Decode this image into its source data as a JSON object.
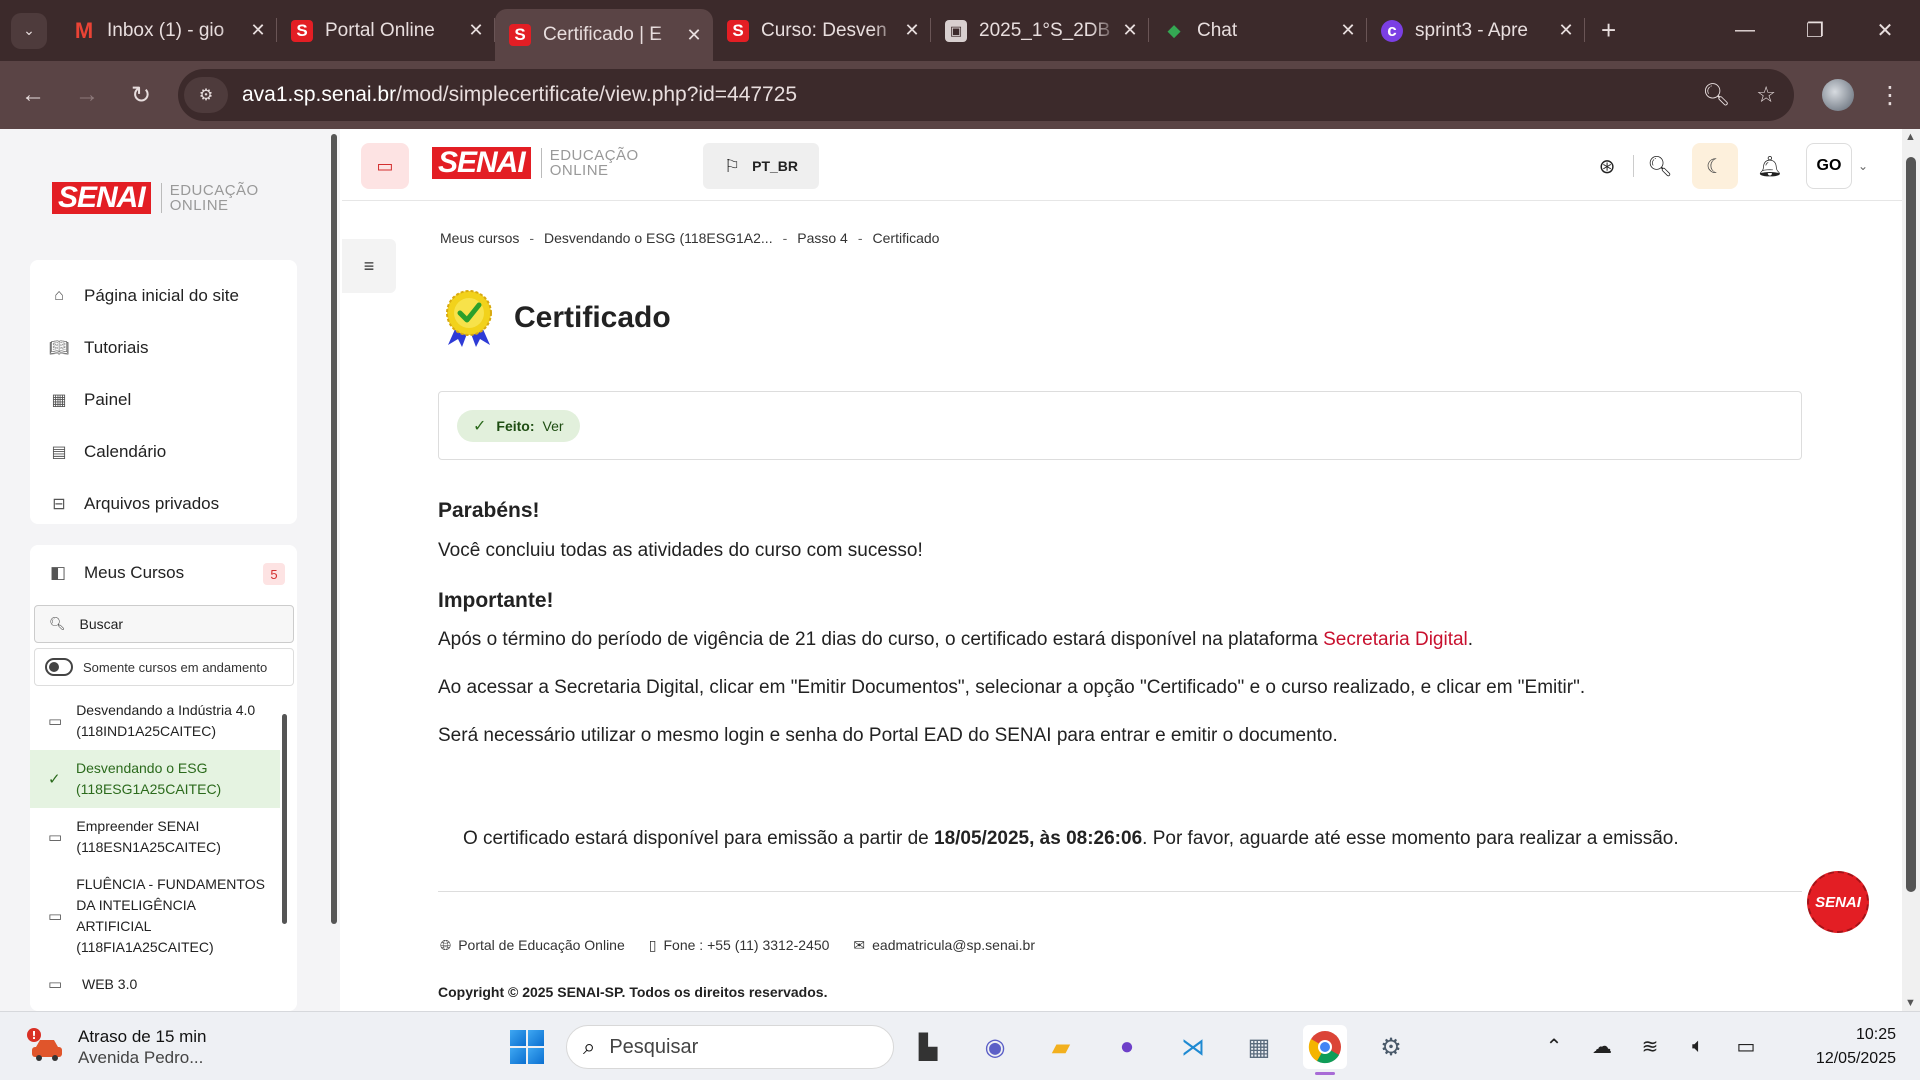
{
  "browser": {
    "tabs": [
      {
        "title": "Inbox (1) - gio",
        "favicon": "gmail-icon",
        "active": false
      },
      {
        "title": "Portal Online",
        "favicon": "senai-icon",
        "active": false
      },
      {
        "title": "Certificado | E",
        "favicon": "senai-icon",
        "active": true
      },
      {
        "title": "Curso: Desven",
        "favicon": "senai-icon",
        "active": false
      },
      {
        "title": "2025_1°S_2DB",
        "favicon": "classroom-icon",
        "active": false
      },
      {
        "title": "Chat",
        "favicon": "chat-icon",
        "active": false
      },
      {
        "title": "sprint3 - Apre",
        "favicon": "canva-icon",
        "active": false
      }
    ],
    "url_host": "ava1.sp.senai.br",
    "url_path": "/mod/simplecertificate/view.php?id=447725"
  },
  "brand": {
    "logo_text": "SENAI",
    "logo_sub_1": "EDUCAÇÃO",
    "logo_sub_2": "ONLINE",
    "red": "#e31e24"
  },
  "sidebar": {
    "nav": [
      {
        "label": "Página inicial do site",
        "icon": "home-icon"
      },
      {
        "label": "Tutoriais",
        "icon": "book-icon"
      },
      {
        "label": "Painel",
        "icon": "dashboard-icon"
      },
      {
        "label": "Calendário",
        "icon": "calendar-icon"
      },
      {
        "label": "Arquivos privados",
        "icon": "archive-icon"
      }
    ],
    "my_courses_label": "Meus Cursos",
    "my_courses_count": "5",
    "search_placeholder": "Buscar",
    "toggle_label": "Somente cursos em andamento",
    "courses": [
      {
        "name": "Desvendando a Indústria 4.0 (118IND1A25CAITEC)",
        "selected": false
      },
      {
        "name": "Desvendando o ESG (118ESG1A25CAITEC)",
        "selected": true
      },
      {
        "name": "Empreender SENAI (118ESN1A25CAITEC)",
        "selected": false
      },
      {
        "name": "FLUÊNCIA - FUNDAMENTOS DA INTELIGÊNCIA ARTIFICIAL (118FIA1A25CAITEC)",
        "selected": false
      },
      {
        "name": "WEB 3.0",
        "selected": false
      }
    ]
  },
  "navbar": {
    "language": "PT_BR",
    "user_initials": "GO"
  },
  "breadcrumb": [
    "Meus cursos",
    "Desvendando o ESG (118ESG1A2...",
    "Passo 4",
    "Certificado"
  ],
  "page": {
    "title": "Certificado",
    "completion_label": "Feito:",
    "completion_value": "Ver",
    "congrats_heading": "Parabéns!",
    "congrats_text": "Você concluiu todas as atividades do curso com sucesso!",
    "important_heading": "Importante!",
    "important_p1_before": "Após o término do período de vigência de 21 dias do curso, o certificado estará disponível na plataforma ",
    "important_p1_link": "Secretaria Digital",
    "important_p1_after": ".",
    "important_p2": "Ao acessar a Secretaria Digital, clicar em \"Emitir Documentos\", selecionar a opção \"Certificado\" e o curso realizado, e clicar em \"Emitir\".",
    "important_p3": "Será necessário utilizar o mesmo login e senha do Portal EAD do SENAI para entrar e emitir o documento.",
    "notice_before": "O certificado estará disponível para emissão a partir de ",
    "notice_date": "18/05/2025, às 08:26:06",
    "notice_after": ". Por favor, aguarde até esse momento para realizar a emissão."
  },
  "footer": {
    "portal": "Portal de Educação Online",
    "phone": "Fone : +55 (11) 3312-2450",
    "email": "eadmatricula@sp.senai.br",
    "copyright": "Copyright © 2025 SENAI-SP. Todos os direitos reservados.",
    "fab_label": "SENAI"
  },
  "taskbar": {
    "weather_title": "Atraso de 15 min",
    "weather_sub": "Avenida Pedro...",
    "search_placeholder": "Pesquisar",
    "time": "10:25",
    "date": "12/05/2025"
  }
}
